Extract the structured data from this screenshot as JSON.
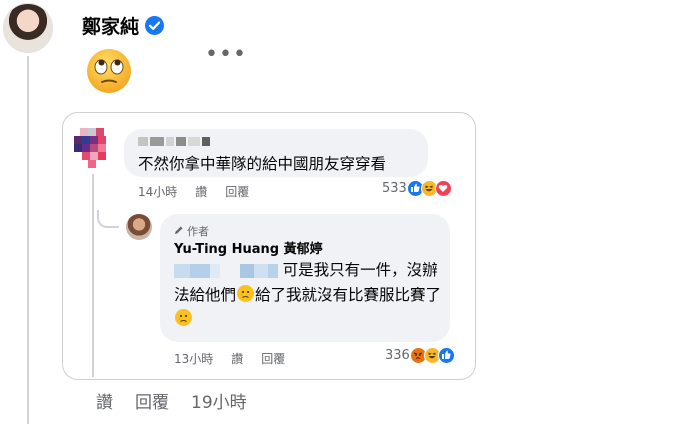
{
  "post": {
    "author_name": "鄭家純",
    "verified_icon": "verified-badge-icon",
    "emoji": "face-with-rolling-eyes",
    "more_options": "•••"
  },
  "shared_comment": {
    "text": "不然你拿中華隊的給中國朋友穿穿看",
    "time": "14小時",
    "like_label": "讚",
    "reply_label": "回覆",
    "reaction_count": "533",
    "reactions": [
      "like-icon",
      "haha-icon",
      "love-icon"
    ]
  },
  "reply": {
    "author_tag": "作者",
    "author_name": "Yu-Ting Huang 黃郁婷",
    "text_part1": "可是我只有一件，沒辦法給他們",
    "text_part2": "給了我就沒有比賽服比賽了",
    "time": "13小時",
    "like_label": "讚",
    "reply_label": "回覆",
    "reaction_count": "336",
    "reactions": [
      "angry-icon",
      "haha-icon",
      "like-icon"
    ]
  },
  "footer": {
    "like_label": "讚",
    "reply_label": "回覆",
    "time": "19小時"
  },
  "colors": {
    "bubble_bg": "#f0f2f5",
    "meta_text": "#65676b",
    "brand_blue": "#1877f2",
    "card_border": "#ced0d4"
  }
}
